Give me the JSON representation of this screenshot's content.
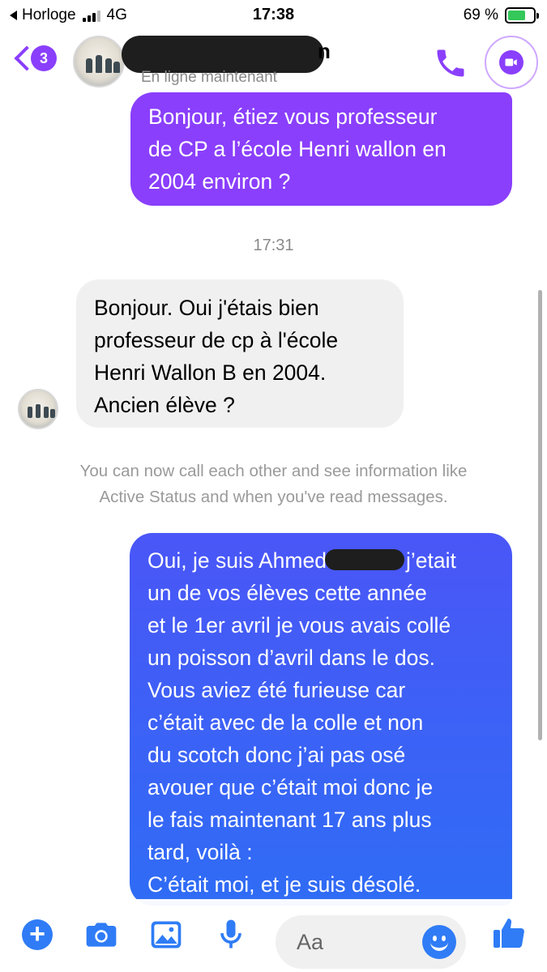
{
  "status_bar": {
    "back_app": "Horloge",
    "network": "4G",
    "time": "17:38",
    "battery": "69 %"
  },
  "header": {
    "unread_count": "3",
    "contact_name_visible": "n",
    "contact_status": "En ligne maintenant"
  },
  "conversation": {
    "timestamp": "17:31",
    "outgoing_1": [
      "Bonjour, étiez vous professeur",
      "de CP a l’école Henri wallon en",
      "2004 environ ?"
    ],
    "incoming_1": [
      "Bonjour. Oui j'étais bien",
      "professeur de cp à l'école",
      "Henri Wallon B en 2004.",
      "Ancien élève ?"
    ],
    "system_note": [
      "You can now call each other and see information like",
      "Active Status and when you've read messages."
    ],
    "outgoing_2": {
      "first_line_start": "Oui, je suis Ahmed",
      "first_line_end": "j’etait",
      "lines": [
        "un de vos élèves cette année",
        "et le 1er avril je vous avais collé",
        "un poisson d’avril dans le dos.",
        "Vous aviez été furieuse car",
        "c’était avec de la colle et non",
        "du scotch donc j’ai pas osé",
        "avouer que c’était moi donc je",
        "le fais maintenant 17 ans plus",
        "tard, voilà :",
        "C’était moi, et je suis désolé."
      ]
    }
  },
  "composer": {
    "placeholder": "Aa"
  },
  "colors": {
    "accent": "#8a3ffc",
    "outgoing_gradient_top": "#4a56f7",
    "outgoing_gradient_bottom": "#2f6cf5",
    "incoming_bubble": "#f0f0f0",
    "composer_icons": "#2f7cf6"
  },
  "icons": {
    "header": [
      "back-chevron-icon",
      "phone-icon",
      "video-camera-icon"
    ],
    "composer": [
      "plus-icon",
      "camera-icon",
      "image-icon",
      "microphone-icon",
      "emoji-icon",
      "thumbs-up-icon"
    ]
  }
}
